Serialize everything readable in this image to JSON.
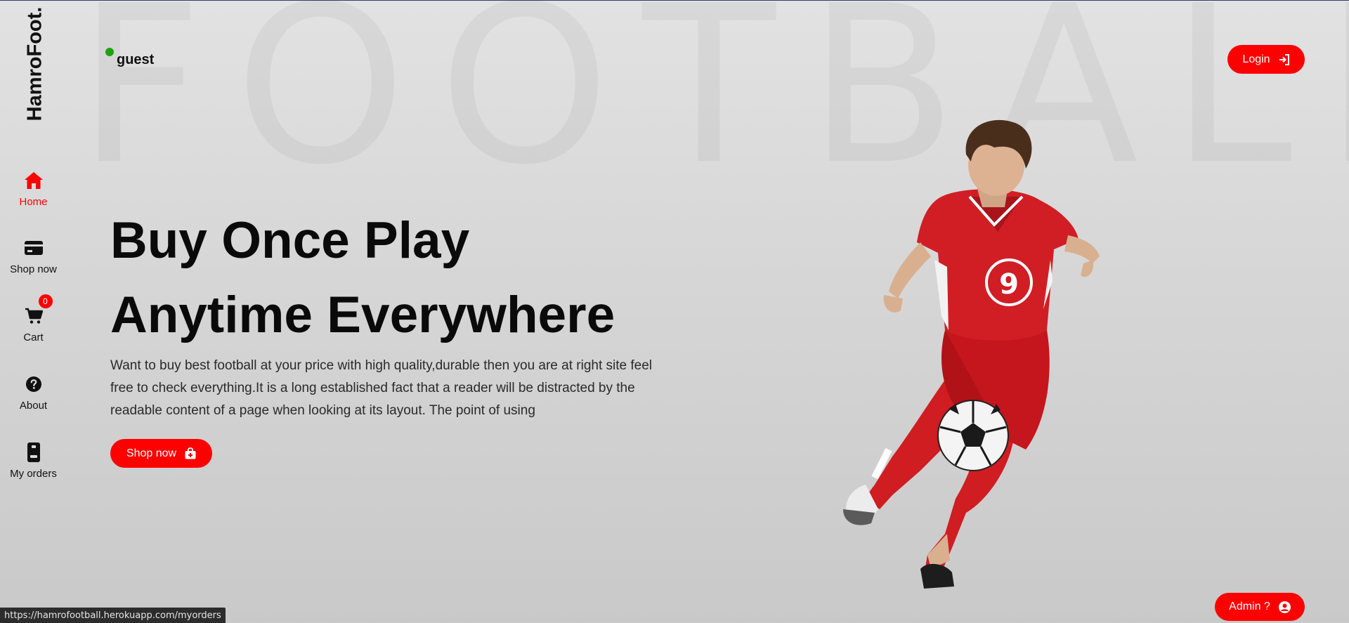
{
  "brand": {
    "name": "HamroFoot."
  },
  "background_word": "FOOTBALL",
  "colors": {
    "accent": "#ff0000",
    "online": "#1ca30f",
    "text": "#111111"
  },
  "nav": {
    "items": [
      {
        "label": "Home",
        "icon": "home-icon",
        "active": true
      },
      {
        "label": "Shop now",
        "icon": "card-icon",
        "active": false
      },
      {
        "label": "Cart",
        "icon": "cart-icon",
        "active": false,
        "badge": "0"
      },
      {
        "label": "About",
        "icon": "question-icon",
        "active": false
      },
      {
        "label": "My orders",
        "icon": "mobile-icon",
        "active": false
      }
    ]
  },
  "user": {
    "name": "guest",
    "status": "online"
  },
  "header": {
    "login_label": "Login",
    "login_icon": "sign-in-icon"
  },
  "hero": {
    "title": "Buy Once Play Anytime Everywhere",
    "description": "Want to buy best football at your price with high quality,durable then you are at right site feel free to check everything.It is a long established fact that a reader will be distracted by the readable content of a page when looking at its layout. The point of using",
    "shop_label": "Shop now",
    "shop_icon": "shopping-bag-icon",
    "image_icon": "football-player-image"
  },
  "admin": {
    "label": "Admin ?",
    "icon": "user-circle-icon"
  },
  "status_bar": {
    "url": "https://hamrofootball.herokuapp.com/myorders"
  }
}
